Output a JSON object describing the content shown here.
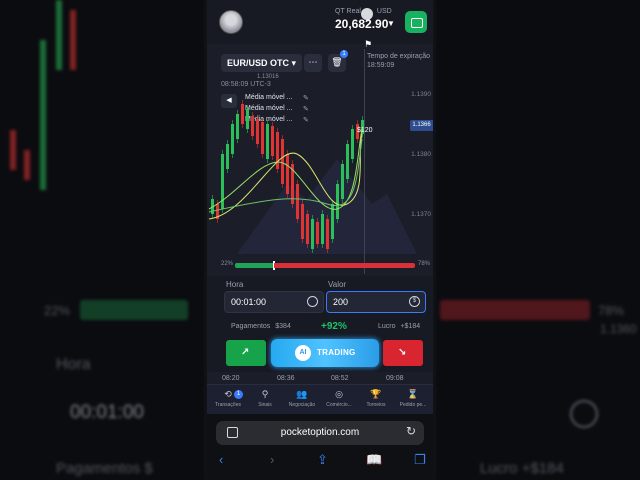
{
  "account": {
    "label": "QT Real",
    "currency": "USD",
    "balance": "20,682.90"
  },
  "asset": {
    "name": "EUR/USD OTC",
    "badge": "1",
    "price_small": "1.13016"
  },
  "expiry": {
    "label": "Tempo de expiração",
    "time": "18:59:09"
  },
  "chart": {
    "clock": "08:58:09 UTC-3",
    "axis_prices": [
      "1.1390",
      "1.1380",
      "1.1370",
      "1.1360"
    ],
    "current_price": "1.1366",
    "profit_label": "$120",
    "indicators": [
      "Média móvel ...",
      "Média móvel ...",
      "Média móvel ..."
    ],
    "icons": {
      "menu": "more-icon",
      "delete": "trash-icon",
      "flag": "flag-icon"
    }
  },
  "sentiment": {
    "up": "22%",
    "down": "78%"
  },
  "trade": {
    "time_label": "Hora",
    "time_value": "00:01:00",
    "amount_label": "Valor",
    "amount_value": "200",
    "payout_label": "Pagamentos",
    "payout_value": "$384",
    "payout_pct": "+92%",
    "profit_label": "Lucro",
    "profit_value": "+$184",
    "ai_badge": "AI",
    "ai_label": "TRADING",
    "up_arrow": "↗",
    "down_arrow": "↘"
  },
  "timeline": [
    "08:20",
    "08:36",
    "08:52",
    "09:08"
  ],
  "nav": [
    {
      "label": "Transações",
      "icon": "history-icon",
      "glyph": "⟲",
      "badge": "1"
    },
    {
      "label": "Sinais",
      "icon": "signal-icon",
      "glyph": "⚲"
    },
    {
      "label": "Negociação",
      "icon": "social-icon",
      "glyph": "👥"
    },
    {
      "label": "Comércio...",
      "icon": "express-icon",
      "glyph": "◎"
    },
    {
      "label": "Torneios",
      "icon": "trophy-icon",
      "glyph": "🏆"
    },
    {
      "label": "Pedido pe...",
      "icon": "hourglass-icon",
      "glyph": "⌛"
    }
  ],
  "browser": {
    "url": "pocketoption.com"
  },
  "background": {
    "pct_left": "22%",
    "pct_right": "78%",
    "hora": "Hora",
    "time": "00:01:00",
    "pagamentos": "Pagamentos $",
    "lucro": "Lucro +$184",
    "price": "1.1360"
  },
  "colors": {
    "up": "#16a34a",
    "down": "#d8252f",
    "accent": "#3a7bfd",
    "ai": "#2b9ce8"
  }
}
